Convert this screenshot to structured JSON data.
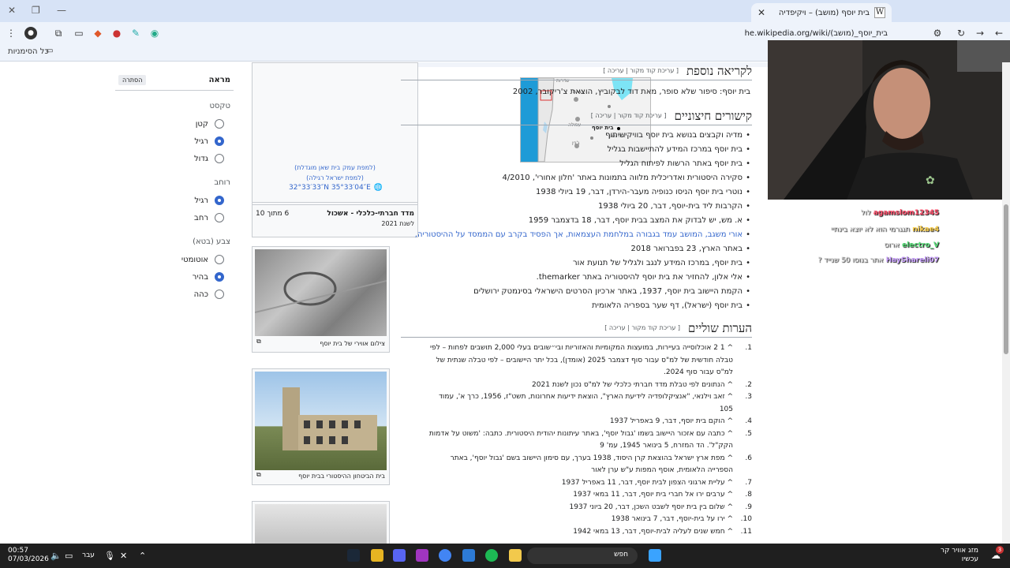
{
  "tab": {
    "title": "בית יוסף (מושב) – ויקיפדיה",
    "favicon": "W"
  },
  "address": {
    "url": "he.wikipedia.org/wiki/בית_יוסף_(מושב)"
  },
  "bookmarks": {
    "all_label": "כל הסימניות"
  },
  "appearance": {
    "title": "מראה",
    "hide": "הסתרה",
    "text_label": "טקסט",
    "text_options": [
      "קטן",
      "רגיל",
      "גדול"
    ],
    "text_selected": 1,
    "width_label": "רוחב",
    "width_options": [
      "רגיל",
      "רחב"
    ],
    "width_selected": 0,
    "color_label": "צבע (בטא)",
    "color_options": [
      "אוטומטי",
      "בהיר",
      "כהה"
    ],
    "color_selected": 1
  },
  "infobox": {
    "map_labels": [
      "שדרות",
      "נצרת",
      "עפולה",
      "בית שאן",
      "ג'נין",
      "בית יוסף"
    ],
    "map_link1": "(למפת עמק בית שאן מוגדלת)",
    "map_link2": "(למפת ישראל רגילה)",
    "coords": "32°33′33″N 35°33′04″E",
    "index_label": "מדד חברתי-כלכלי - אשכול",
    "index_value": "6 מתוך 10",
    "index_year": "לשנת 2021"
  },
  "images": [
    {
      "caption": "צילום אווירי של בית יוסף"
    },
    {
      "caption": "בית הביטחון ההיסטורי בבית יוסף"
    }
  ],
  "sections": {
    "further_title": "לקריאה נוספת",
    "edit_label": "[ עריכת קוד מקור | עריכה ]",
    "further_text": "בית יוסף: סיפור שלא סופר, מאת דוד לבקוביץ, הוצאת צ'ריקובר, 2002",
    "external_title": "קישורים חיצוניים",
    "external": [
      "מדיה וקבצים בנושא בית יוסף בוויקישיתוף",
      "בית יוסף במרכז המידע להתיישבות בגליל",
      "בית יוסף באתר הרשות לפיתוח הגליל",
      "סקירה היסטורית ואדריכלית מלווה בתמונות באתר 'חלון אחורי', 4/2010",
      "נוטרי בית יוסף הניסו כנופיה מעבר-הירדן, דבר, 19 ביולי 1938",
      "הקרבות ליד בית-יוסף, דבר, 20 ביולי 1938",
      "א. מש, יש לבדוק את המצב בבית יוסף, דבר, 18 בדצמבר 1959",
      "אורי משגב, המושב עמד בגבורה במלחמת העצמאות, אך הפסיד בקרב עם הממסד על ההיסטוריה,",
      "באתר הארץ, 23 בפברואר 2018",
      "בית יוסף, במרכז המידע לנגב ולגליל של תנועת אור",
      "אלי אלון, להחזיר את בית יוסף להיסטוריה באתר themarker.",
      "הקמת היישוב בית יוסף, 1937, באתר ארכיון הסרטים הישראלי בסינמטק ירושלים",
      "בית יוסף (ישראל), דף שער בספריה הלאומית"
    ],
    "notes_title": "הערות שוליים",
    "notes": [
      "^ 1 2 אוכלוסייה בעיירות, במועצות המקומיות והאזוריות ובי״שובים בעלי 2,000 תושבים לפחות – לפי טבלה חודשית של למ\"ס עבור סוף דצמבר 2025 (אומדן), בכל יתר היישובים – לפי טבלה שנתית של למ\"ס עבור סוף 2024.",
      "^ הנתונים לפי טבלת מדד חברתי כלכלי של למ\"ס נכון לשנת 2021",
      "^ זאב וילנאי, \"אנציקלופדיה לידיעת הארץ\", הוצאת ידיעות אחרונות, תשט\"ז, 1956, כרך א', עמוד 105",
      "^ הוקם בית יוסף, דבר, 9 באפריל 1937",
      "^ כתבה עם אזכור היישוב בשמו 'גבול יוסף', באתר עיתונות יהודית היסטורית. כתבה: 'משוט על אדמות הקק\"ל'. הד המזרח, 5 בינואר 1945, עמ' 9",
      "^ מפת ארץ ישראל בהוצאת קרן היסוד, 1938 בערך, עם סימון היישוב בשם 'גבול יוסף', באתר הספרייה הלאומית, אוסף המפות ע\"ש ערן לאור",
      "^ עליית ארגוני הצפון לבית יוסף, דבר, 11 באפריל 1937",
      "^ ערבים ירו אל חברי בית יוסף, דבר, 11 במאי 1937",
      "^ שלום בין בית יוסף לשבט השכן, דבר, 20 ביוני 1937",
      "^ ירו על בית-יוסף, דבר, 7 בינואר 1938",
      "^ חמש שנים לעליה לבית-יוסף, דבר, 13 במאי 1942"
    ]
  },
  "chat": [
    {
      "user": "agamslom12345",
      "msg": "לול",
      "color": "#ff4d6a"
    },
    {
      "user": "nikae4",
      "msg": "תגגרמי הוא לא יוצא בינתיי",
      "color": "#ffd34d"
    },
    {
      "user": "electro_V",
      "msg": "ארוס",
      "color": "#59e07a"
    },
    {
      "user": "HayShareli07",
      "msg": "אתר בנוסו 50 שנייד ?",
      "color": "#c9a0ff"
    }
  ],
  "taskbar": {
    "time": "00:57",
    "date": "07/03/2026",
    "lang": "עבר",
    "search": "חפש",
    "weather_title": "מזג אוויר קר",
    "weather_sub": "עכשיו",
    "badge": "3"
  }
}
